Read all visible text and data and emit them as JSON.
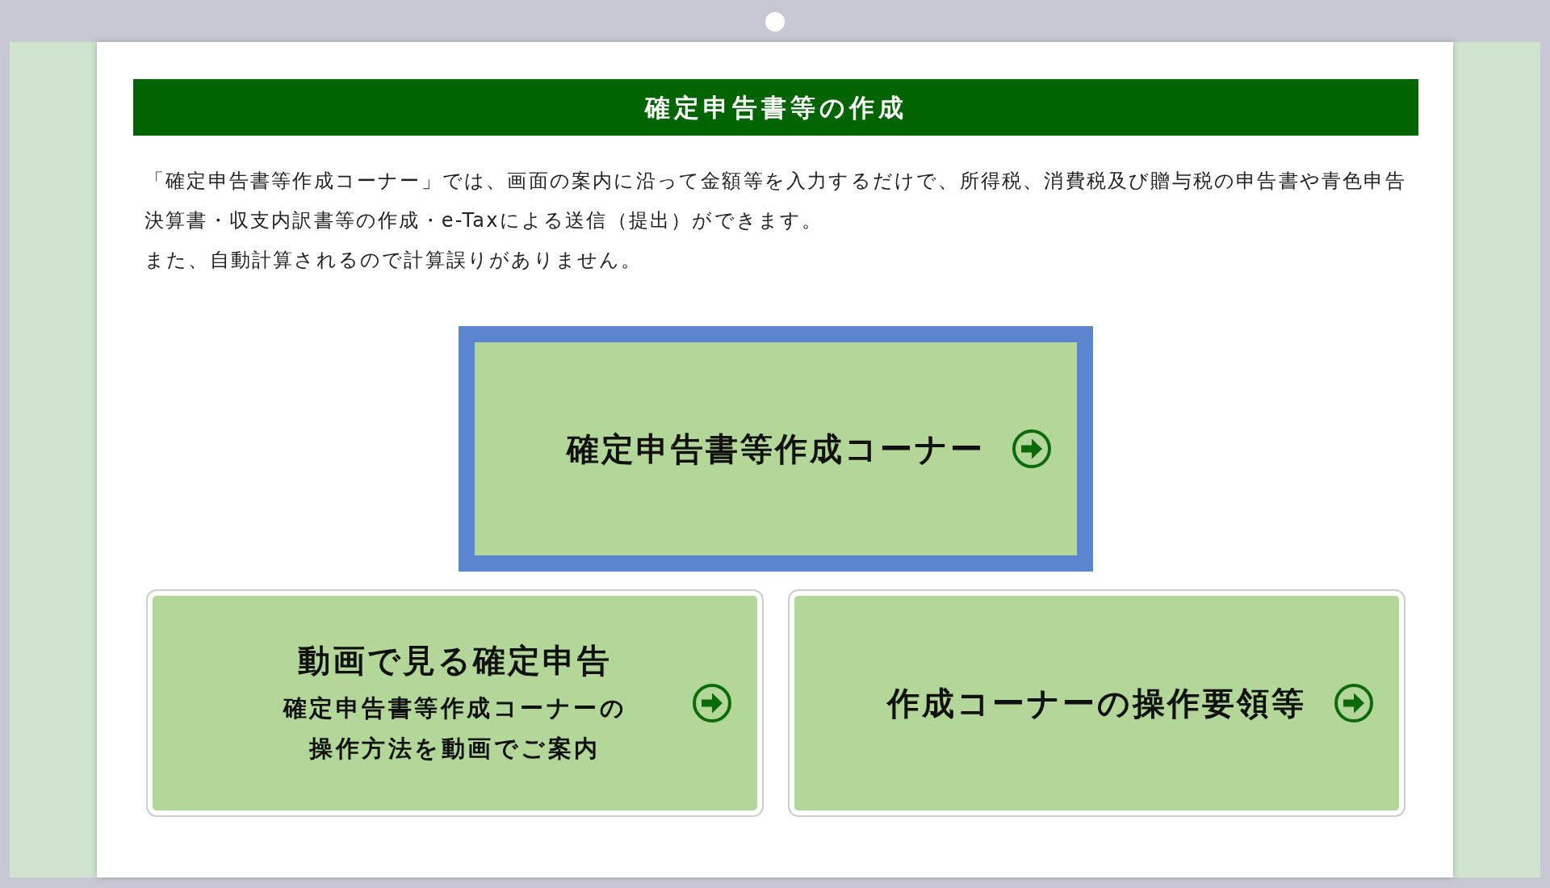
{
  "header": {
    "title": "確定申告書等の作成"
  },
  "intro": [
    "「確定申告書等作成コーナー」では、画面の案内に沿って金額等を入力するだけで、所得税、消費税及び贈与税の申告書や青色申告決算書・収支内訳書等の作成・e-Taxによる送信（提出）ができます。",
    "また、自動計算されるので計算誤りがありません。"
  ],
  "main_link": {
    "title": "確定申告書等作成コーナー",
    "focused": true
  },
  "links": [
    {
      "title": "動画で見る確定申告",
      "subtitle": "確定申告書等作成コーナーの操作方法を動画でご案内",
      "focused": false
    },
    {
      "title": "作成コーナーの操作要領等",
      "focused": false
    }
  ]
}
